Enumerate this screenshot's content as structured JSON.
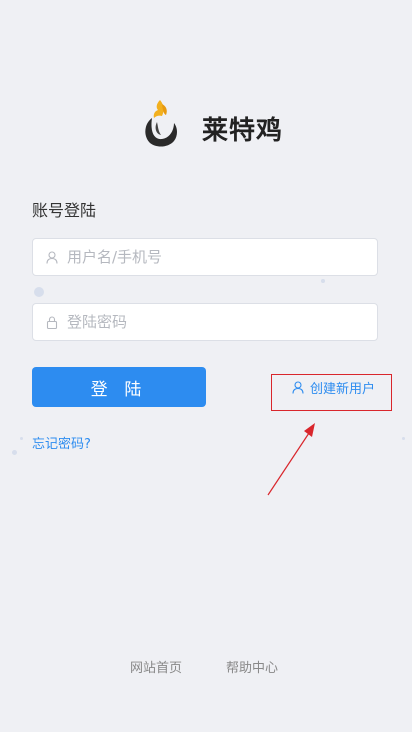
{
  "brand": {
    "name": "莱特鸡"
  },
  "login": {
    "section_title": "账号登陆",
    "username_placeholder": "用户名/手机号",
    "password_placeholder": "登陆密码",
    "submit_label": "登 陆",
    "create_user_label": "创建新用户",
    "forgot_password_label": "忘记密码?"
  },
  "footer": {
    "links": [
      "网站首页",
      "帮助中心"
    ]
  },
  "colors": {
    "primary": "#2d8cf0",
    "annotation": "#d9262c",
    "background": "#eff0f4"
  }
}
